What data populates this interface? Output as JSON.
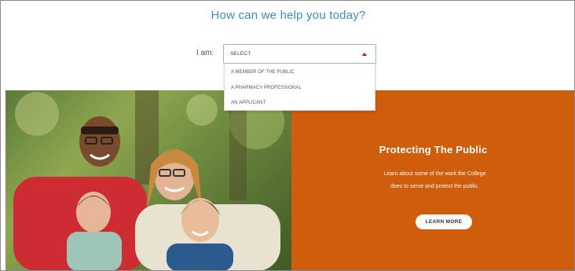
{
  "header": {
    "title": "How can we help you today?"
  },
  "selector": {
    "label": "I am:",
    "value": "SELECT",
    "options": [
      "A MEMBER OF THE PUBLIC",
      "A PHARMACY PROFESSIONAL",
      "AN APPLICANT"
    ]
  },
  "hero": {
    "image_description": "Family photo: smiling man, woman and two young children outdoors",
    "panel": {
      "title": "Protecting The Public",
      "text": "Learn about some of the work the College does to serve and protect the public.",
      "button_label": "LEARN MORE",
      "background_color": "#d05d0c"
    }
  },
  "colors": {
    "accent": "#3a8fc7",
    "caret": "#b0102a"
  }
}
